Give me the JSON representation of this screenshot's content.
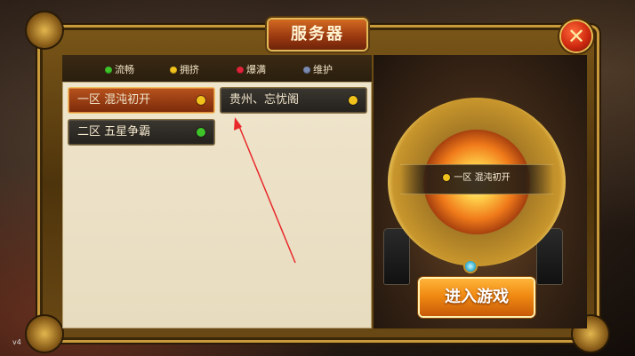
{
  "dialog": {
    "title": "服务器",
    "close_icon": "✕"
  },
  "legend": [
    {
      "label": "流畅",
      "color": "#3ec42a"
    },
    {
      "label": "拥挤",
      "color": "#f2c21c"
    },
    {
      "label": "爆满",
      "color": "#e0243a"
    },
    {
      "label": "维护",
      "color": "#7a8ab0"
    }
  ],
  "servers": [
    {
      "label": "一区  混沌初开",
      "status_color": "#f2c21c",
      "selected": true
    },
    {
      "label": "贵州、忘忧阁",
      "status_color": "#f2c21c",
      "selected": false
    },
    {
      "label": "二区  五星争霸",
      "status_color": "#3ec42a",
      "selected": false
    }
  ],
  "selected_server": {
    "label": "一区  混沌初开",
    "status_color": "#f2c21c"
  },
  "enter_button": "进入游戏",
  "version": "v4",
  "annotation": {
    "color": "#e8282a"
  }
}
